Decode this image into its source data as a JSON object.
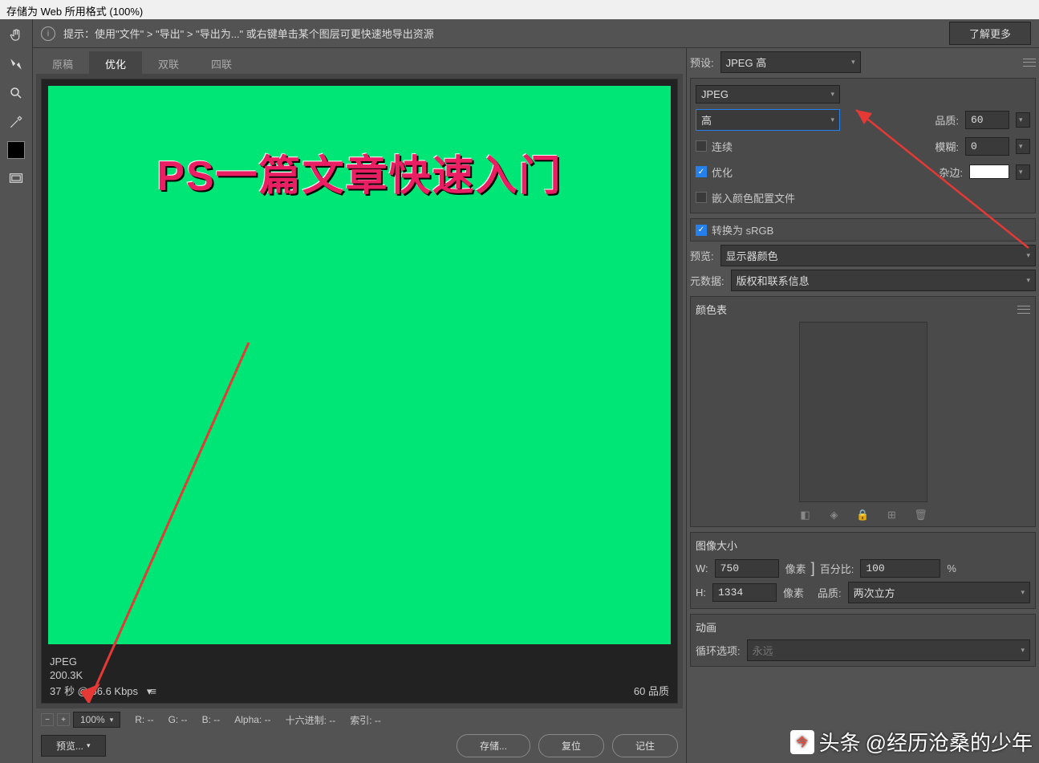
{
  "titlebar": "存储为 Web 所用格式 (100%)",
  "tip": {
    "label": "提示：",
    "text": "使用\"文件\" > \"导出\" > \"导出为...\" 或右键单击某个图层可更快速地导出资源",
    "learn_more": "了解更多"
  },
  "tabs": {
    "original": "原稿",
    "optimized": "优化",
    "two_up": "双联",
    "four_up": "四联"
  },
  "image_headline": "PS一篇文章快速入门",
  "meta": {
    "format": "JPEG",
    "quality_label": "60 品质",
    "size": "200.3K",
    "time": "37 秒 @ 56.6 Kbps"
  },
  "bottom": {
    "zoom": "100%",
    "r": "R: --",
    "g": "G: --",
    "b": "B: --",
    "alpha": "Alpha: --",
    "hex": "十六进制: --",
    "idx": "索引: --"
  },
  "footer": {
    "preview": "预览...",
    "save": "存储...",
    "reset": "复位",
    "remember": "记住"
  },
  "right": {
    "preset_label": "预设:",
    "preset_value": "JPEG 高",
    "format": "JPEG",
    "quality_level": "高",
    "quality_label": "品质:",
    "quality_value": "60",
    "progressive": "连续",
    "blur_label": "模糊:",
    "blur_value": "0",
    "optimized": "优化",
    "matte_label": "杂边:",
    "embed_profile": "嵌入颜色配置文件",
    "convert_srgb": "转换为 sRGB",
    "preview_label": "预览:",
    "preview_value": "显示器颜色",
    "metadata_label": "元数据:",
    "metadata_value": "版权和联系信息",
    "colortable": "颜色表",
    "imagesize": "图像大小",
    "w_label": "W:",
    "w_value": "750",
    "h_label": "H:",
    "h_value": "1334",
    "px": "像素",
    "percent_label": "百分比:",
    "percent_value": "100",
    "percent_unit": "%",
    "quality2_label": "品质:",
    "quality2_value": "两次立方",
    "anim": "动画",
    "loop_label": "循环选项:",
    "loop_value": "永远"
  },
  "watermark": {
    "brand": "头条",
    "author": "@经历沧桑的少年"
  }
}
